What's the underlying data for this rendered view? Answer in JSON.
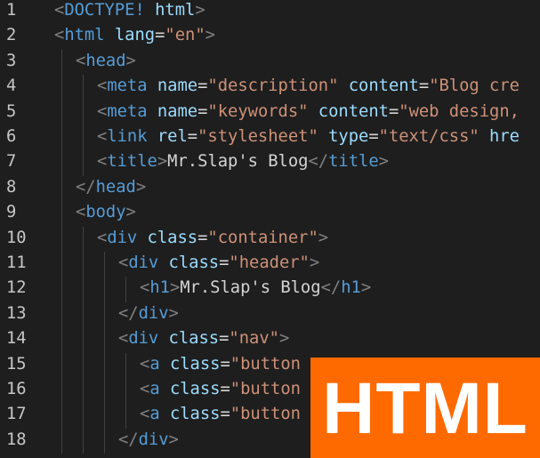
{
  "editor": {
    "lines": [
      {
        "num": "1",
        "indent": 0,
        "tokens": [
          {
            "t": "tag-bracket",
            "v": "<"
          },
          {
            "t": "tag",
            "v": "DOCTYPE!"
          },
          {
            "t": "txt",
            "v": " "
          },
          {
            "t": "attr",
            "v": "html"
          },
          {
            "t": "tag-bracket",
            "v": ">"
          }
        ]
      },
      {
        "num": "2",
        "indent": 0,
        "tokens": [
          {
            "t": "tag-bracket",
            "v": "<"
          },
          {
            "t": "tag",
            "v": "html"
          },
          {
            "t": "txt",
            "v": " "
          },
          {
            "t": "attr",
            "v": "lang"
          },
          {
            "t": "op",
            "v": "="
          },
          {
            "t": "str",
            "v": "\"en\""
          },
          {
            "t": "tag-bracket",
            "v": ">"
          }
        ]
      },
      {
        "num": "3",
        "indent": 1,
        "tokens": [
          {
            "t": "tag-bracket",
            "v": "<"
          },
          {
            "t": "tag",
            "v": "head"
          },
          {
            "t": "tag-bracket",
            "v": ">"
          }
        ]
      },
      {
        "num": "4",
        "indent": 2,
        "tokens": [
          {
            "t": "tag-bracket",
            "v": "<"
          },
          {
            "t": "tag",
            "v": "meta"
          },
          {
            "t": "txt",
            "v": " "
          },
          {
            "t": "attr",
            "v": "name"
          },
          {
            "t": "op",
            "v": "="
          },
          {
            "t": "str",
            "v": "\"description\""
          },
          {
            "t": "txt",
            "v": " "
          },
          {
            "t": "attr",
            "v": "content"
          },
          {
            "t": "op",
            "v": "="
          },
          {
            "t": "str",
            "v": "\"Blog cre"
          }
        ]
      },
      {
        "num": "5",
        "indent": 2,
        "tokens": [
          {
            "t": "tag-bracket",
            "v": "<"
          },
          {
            "t": "tag",
            "v": "meta"
          },
          {
            "t": "txt",
            "v": " "
          },
          {
            "t": "attr",
            "v": "name"
          },
          {
            "t": "op",
            "v": "="
          },
          {
            "t": "str",
            "v": "\"keywords\""
          },
          {
            "t": "txt",
            "v": " "
          },
          {
            "t": "attr",
            "v": "content"
          },
          {
            "t": "op",
            "v": "="
          },
          {
            "t": "str",
            "v": "\"web design,"
          }
        ]
      },
      {
        "num": "6",
        "indent": 2,
        "tokens": [
          {
            "t": "tag-bracket",
            "v": "<"
          },
          {
            "t": "tag",
            "v": "link"
          },
          {
            "t": "txt",
            "v": " "
          },
          {
            "t": "attr",
            "v": "rel"
          },
          {
            "t": "op",
            "v": "="
          },
          {
            "t": "str",
            "v": "\"stylesheet\""
          },
          {
            "t": "txt",
            "v": " "
          },
          {
            "t": "attr",
            "v": "type"
          },
          {
            "t": "op",
            "v": "="
          },
          {
            "t": "str",
            "v": "\"text/css\""
          },
          {
            "t": "txt",
            "v": " "
          },
          {
            "t": "attr",
            "v": "hre"
          }
        ]
      },
      {
        "num": "7",
        "indent": 2,
        "tokens": [
          {
            "t": "tag-bracket",
            "v": "<"
          },
          {
            "t": "tag",
            "v": "title"
          },
          {
            "t": "tag-bracket",
            "v": ">"
          },
          {
            "t": "txt",
            "v": "Mr.Slap's Blog"
          },
          {
            "t": "tag-bracket",
            "v": "</"
          },
          {
            "t": "tag",
            "v": "title"
          },
          {
            "t": "tag-bracket",
            "v": ">"
          }
        ]
      },
      {
        "num": "8",
        "indent": 1,
        "tokens": [
          {
            "t": "tag-bracket",
            "v": "</"
          },
          {
            "t": "tag",
            "v": "head"
          },
          {
            "t": "tag-bracket",
            "v": ">"
          }
        ]
      },
      {
        "num": "9",
        "indent": 1,
        "tokens": [
          {
            "t": "tag-bracket",
            "v": "<"
          },
          {
            "t": "tag",
            "v": "body"
          },
          {
            "t": "tag-bracket",
            "v": ">"
          }
        ]
      },
      {
        "num": "10",
        "indent": 2,
        "tokens": [
          {
            "t": "tag-bracket",
            "v": "<"
          },
          {
            "t": "tag",
            "v": "div"
          },
          {
            "t": "txt",
            "v": " "
          },
          {
            "t": "attr",
            "v": "class"
          },
          {
            "t": "op",
            "v": "="
          },
          {
            "t": "str",
            "v": "\"container\""
          },
          {
            "t": "tag-bracket",
            "v": ">"
          }
        ]
      },
      {
        "num": "11",
        "indent": 3,
        "tokens": [
          {
            "t": "tag-bracket",
            "v": "<"
          },
          {
            "t": "tag",
            "v": "div"
          },
          {
            "t": "txt",
            "v": " "
          },
          {
            "t": "attr",
            "v": "class"
          },
          {
            "t": "op",
            "v": "="
          },
          {
            "t": "str",
            "v": "\"header\""
          },
          {
            "t": "tag-bracket",
            "v": ">"
          }
        ]
      },
      {
        "num": "12",
        "indent": 4,
        "tokens": [
          {
            "t": "tag-bracket",
            "v": "<"
          },
          {
            "t": "tag",
            "v": "h1"
          },
          {
            "t": "tag-bracket",
            "v": ">"
          },
          {
            "t": "txt",
            "v": "Mr.Slap's Blog"
          },
          {
            "t": "tag-bracket",
            "v": "</"
          },
          {
            "t": "tag",
            "v": "h1"
          },
          {
            "t": "tag-bracket",
            "v": ">"
          }
        ]
      },
      {
        "num": "13",
        "indent": 3,
        "tokens": [
          {
            "t": "tag-bracket",
            "v": "</"
          },
          {
            "t": "tag",
            "v": "div"
          },
          {
            "t": "tag-bracket",
            "v": ">"
          }
        ]
      },
      {
        "num": "14",
        "indent": 3,
        "tokens": [
          {
            "t": "tag-bracket",
            "v": "<"
          },
          {
            "t": "tag",
            "v": "div"
          },
          {
            "t": "txt",
            "v": " "
          },
          {
            "t": "attr",
            "v": "class"
          },
          {
            "t": "op",
            "v": "="
          },
          {
            "t": "str",
            "v": "\"nav\""
          },
          {
            "t": "tag-bracket",
            "v": ">"
          }
        ]
      },
      {
        "num": "15",
        "indent": 4,
        "tokens": [
          {
            "t": "tag-bracket",
            "v": "<"
          },
          {
            "t": "tag",
            "v": "a"
          },
          {
            "t": "txt",
            "v": " "
          },
          {
            "t": "attr",
            "v": "class"
          },
          {
            "t": "op",
            "v": "="
          },
          {
            "t": "str",
            "v": "\"button"
          }
        ]
      },
      {
        "num": "16",
        "indent": 4,
        "tokens": [
          {
            "t": "tag-bracket",
            "v": "<"
          },
          {
            "t": "tag",
            "v": "a"
          },
          {
            "t": "txt",
            "v": " "
          },
          {
            "t": "attr",
            "v": "class"
          },
          {
            "t": "op",
            "v": "="
          },
          {
            "t": "str",
            "v": "\"button"
          }
        ]
      },
      {
        "num": "17",
        "indent": 4,
        "tokens": [
          {
            "t": "tag-bracket",
            "v": "<"
          },
          {
            "t": "tag",
            "v": "a"
          },
          {
            "t": "txt",
            "v": " "
          },
          {
            "t": "attr",
            "v": "class"
          },
          {
            "t": "op",
            "v": "="
          },
          {
            "t": "str",
            "v": "\"button"
          }
        ]
      },
      {
        "num": "18",
        "indent": 3,
        "tokens": [
          {
            "t": "tag-bracket",
            "v": "</"
          },
          {
            "t": "tag",
            "v": "div"
          },
          {
            "t": "tag-bracket",
            "v": ">"
          }
        ]
      }
    ]
  },
  "badge": {
    "label": "HTML",
    "color": "#ff6a00"
  },
  "colors": {
    "background": "#1e1e1e",
    "tag": "#569cd6",
    "attribute": "#9cdcfe",
    "string": "#ce9178",
    "text": "#d4d4d4",
    "bracket": "#808080",
    "line_number": "#c6c6c6"
  }
}
